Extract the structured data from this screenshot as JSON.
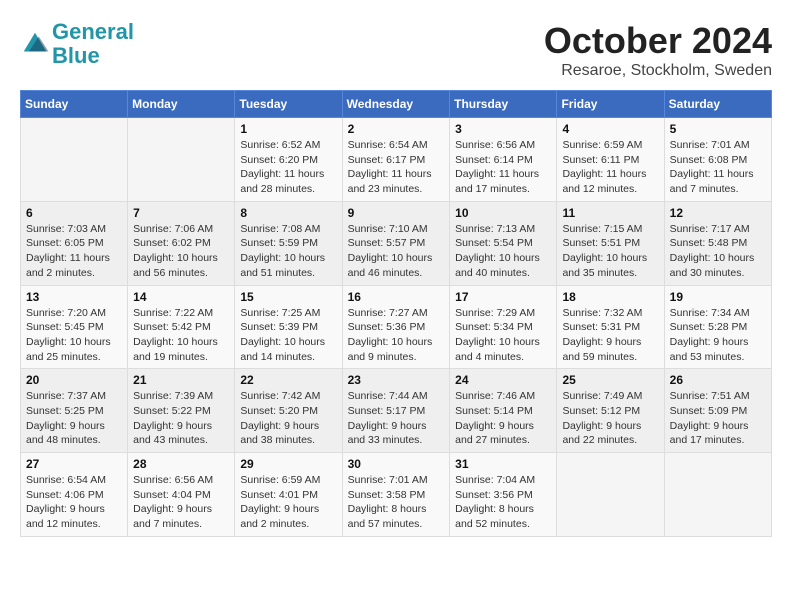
{
  "logo": {
    "line1": "General",
    "line2": "Blue"
  },
  "title": "October 2024",
  "location": "Resaroe, Stockholm, Sweden",
  "days_of_week": [
    "Sunday",
    "Monday",
    "Tuesday",
    "Wednesday",
    "Thursday",
    "Friday",
    "Saturday"
  ],
  "weeks": [
    [
      {
        "day": "",
        "info": ""
      },
      {
        "day": "",
        "info": ""
      },
      {
        "day": "1",
        "info": "Sunrise: 6:52 AM\nSunset: 6:20 PM\nDaylight: 11 hours and 28 minutes."
      },
      {
        "day": "2",
        "info": "Sunrise: 6:54 AM\nSunset: 6:17 PM\nDaylight: 11 hours and 23 minutes."
      },
      {
        "day": "3",
        "info": "Sunrise: 6:56 AM\nSunset: 6:14 PM\nDaylight: 11 hours and 17 minutes."
      },
      {
        "day": "4",
        "info": "Sunrise: 6:59 AM\nSunset: 6:11 PM\nDaylight: 11 hours and 12 minutes."
      },
      {
        "day": "5",
        "info": "Sunrise: 7:01 AM\nSunset: 6:08 PM\nDaylight: 11 hours and 7 minutes."
      }
    ],
    [
      {
        "day": "6",
        "info": "Sunrise: 7:03 AM\nSunset: 6:05 PM\nDaylight: 11 hours and 2 minutes."
      },
      {
        "day": "7",
        "info": "Sunrise: 7:06 AM\nSunset: 6:02 PM\nDaylight: 10 hours and 56 minutes."
      },
      {
        "day": "8",
        "info": "Sunrise: 7:08 AM\nSunset: 5:59 PM\nDaylight: 10 hours and 51 minutes."
      },
      {
        "day": "9",
        "info": "Sunrise: 7:10 AM\nSunset: 5:57 PM\nDaylight: 10 hours and 46 minutes."
      },
      {
        "day": "10",
        "info": "Sunrise: 7:13 AM\nSunset: 5:54 PM\nDaylight: 10 hours and 40 minutes."
      },
      {
        "day": "11",
        "info": "Sunrise: 7:15 AM\nSunset: 5:51 PM\nDaylight: 10 hours and 35 minutes."
      },
      {
        "day": "12",
        "info": "Sunrise: 7:17 AM\nSunset: 5:48 PM\nDaylight: 10 hours and 30 minutes."
      }
    ],
    [
      {
        "day": "13",
        "info": "Sunrise: 7:20 AM\nSunset: 5:45 PM\nDaylight: 10 hours and 25 minutes."
      },
      {
        "day": "14",
        "info": "Sunrise: 7:22 AM\nSunset: 5:42 PM\nDaylight: 10 hours and 19 minutes."
      },
      {
        "day": "15",
        "info": "Sunrise: 7:25 AM\nSunset: 5:39 PM\nDaylight: 10 hours and 14 minutes."
      },
      {
        "day": "16",
        "info": "Sunrise: 7:27 AM\nSunset: 5:36 PM\nDaylight: 10 hours and 9 minutes."
      },
      {
        "day": "17",
        "info": "Sunrise: 7:29 AM\nSunset: 5:34 PM\nDaylight: 10 hours and 4 minutes."
      },
      {
        "day": "18",
        "info": "Sunrise: 7:32 AM\nSunset: 5:31 PM\nDaylight: 9 hours and 59 minutes."
      },
      {
        "day": "19",
        "info": "Sunrise: 7:34 AM\nSunset: 5:28 PM\nDaylight: 9 hours and 53 minutes."
      }
    ],
    [
      {
        "day": "20",
        "info": "Sunrise: 7:37 AM\nSunset: 5:25 PM\nDaylight: 9 hours and 48 minutes."
      },
      {
        "day": "21",
        "info": "Sunrise: 7:39 AM\nSunset: 5:22 PM\nDaylight: 9 hours and 43 minutes."
      },
      {
        "day": "22",
        "info": "Sunrise: 7:42 AM\nSunset: 5:20 PM\nDaylight: 9 hours and 38 minutes."
      },
      {
        "day": "23",
        "info": "Sunrise: 7:44 AM\nSunset: 5:17 PM\nDaylight: 9 hours and 33 minutes."
      },
      {
        "day": "24",
        "info": "Sunrise: 7:46 AM\nSunset: 5:14 PM\nDaylight: 9 hours and 27 minutes."
      },
      {
        "day": "25",
        "info": "Sunrise: 7:49 AM\nSunset: 5:12 PM\nDaylight: 9 hours and 22 minutes."
      },
      {
        "day": "26",
        "info": "Sunrise: 7:51 AM\nSunset: 5:09 PM\nDaylight: 9 hours and 17 minutes."
      }
    ],
    [
      {
        "day": "27",
        "info": "Sunrise: 6:54 AM\nSunset: 4:06 PM\nDaylight: 9 hours and 12 minutes."
      },
      {
        "day": "28",
        "info": "Sunrise: 6:56 AM\nSunset: 4:04 PM\nDaylight: 9 hours and 7 minutes."
      },
      {
        "day": "29",
        "info": "Sunrise: 6:59 AM\nSunset: 4:01 PM\nDaylight: 9 hours and 2 minutes."
      },
      {
        "day": "30",
        "info": "Sunrise: 7:01 AM\nSunset: 3:58 PM\nDaylight: 8 hours and 57 minutes."
      },
      {
        "day": "31",
        "info": "Sunrise: 7:04 AM\nSunset: 3:56 PM\nDaylight: 8 hours and 52 minutes."
      },
      {
        "day": "",
        "info": ""
      },
      {
        "day": "",
        "info": ""
      }
    ]
  ]
}
